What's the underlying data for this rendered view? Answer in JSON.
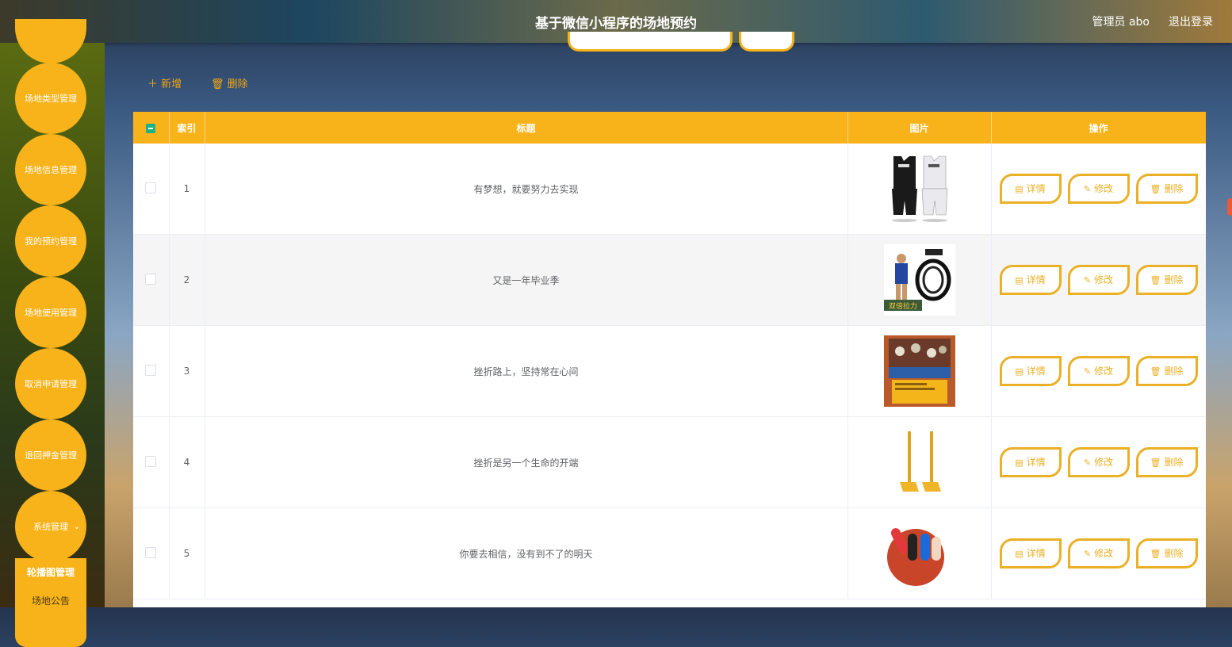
{
  "header": {
    "title": "基于微信小程序的场地预约",
    "admin": "管理员 abo",
    "logout": "退出登录"
  },
  "sidebar": {
    "items": [
      {
        "label": "场地类型管理"
      },
      {
        "label": "场地信息管理"
      },
      {
        "label": "我的预约管理"
      },
      {
        "label": "场地使用管理"
      },
      {
        "label": "取消申请管理"
      },
      {
        "label": "退回押金管理"
      },
      {
        "label": "系统管理"
      }
    ],
    "submenu": [
      {
        "label": "轮播图管理"
      },
      {
        "label": "场地公告"
      }
    ]
  },
  "toolbar": {
    "add_label": "新增",
    "delete_label": "删除"
  },
  "table": {
    "headers": {
      "index": "索引",
      "title": "标题",
      "image": "图片",
      "action": "操作"
    },
    "actions": {
      "detail": "详情",
      "edit": "修改",
      "delete": "删除"
    },
    "rows": [
      {
        "index": "1",
        "title": "有梦想，就要努力去实现",
        "image": "basketball-jersey"
      },
      {
        "index": "2",
        "title": "又是一年毕业季",
        "image": "resistance-band"
      },
      {
        "index": "3",
        "title": "挫折路上，坚持常在心间",
        "image": "sports-book"
      },
      {
        "index": "4",
        "title": "挫折是另一个生命的开端",
        "image": "badminton-net-stand"
      },
      {
        "index": "5",
        "title": "你要去相信，没有到不了的明天",
        "image": "finger-sleeves"
      }
    ],
    "image_printed_text": {
      "resistance-band": "双倍拉力"
    }
  },
  "colors": {
    "accent": "#f8b31a",
    "action_border": "#eab026",
    "checkbox_checked": "#19b38a"
  }
}
